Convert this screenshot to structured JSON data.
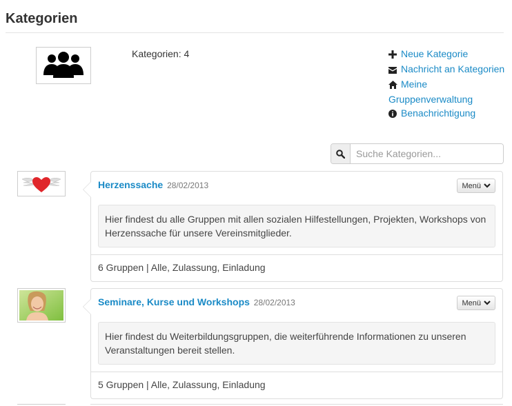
{
  "page": {
    "title": "Kategorien"
  },
  "summary": {
    "count_label": "Kategorien: 4"
  },
  "actions": [
    {
      "icon": "plus-icon",
      "label": "Neue Kategorie"
    },
    {
      "icon": "envelope-icon",
      "label": "Nachricht an Kategorien"
    },
    {
      "icon": "home-icon",
      "label": "Meine Gruppenverwaltung"
    },
    {
      "icon": "info-icon",
      "label": "Benachrichtigung"
    }
  ],
  "search": {
    "placeholder": "Suche Kategorien..."
  },
  "categories": [
    {
      "name": "Herzenssache",
      "date": "28/02/2013",
      "menu_label": "Menü",
      "description": "Hier findest du alle Gruppen mit allen sozialen Hilfestellungen, Projekten, Workshops von Herzenssache für unsere Vereinsmitglieder.",
      "footer": "6 Gruppen | Alle, Zulassung, Einladung",
      "image": "winged-heart-image"
    },
    {
      "name": "Seminare, Kurse und Workshops",
      "date": "28/02/2013",
      "menu_label": "Menü",
      "description": "Hier findest du Weiterbildungsgruppen, die weiterführende Informationen zu unseren Veranstaltungen bereit stellen.",
      "footer": "5 Gruppen | Alle, Zulassung, Einladung",
      "image": "smiling-woman-photo"
    }
  ],
  "colors": {
    "link": "#1a8ac6",
    "text": "#333333",
    "border": "#dddddd",
    "panel": "#f5f5f5"
  }
}
